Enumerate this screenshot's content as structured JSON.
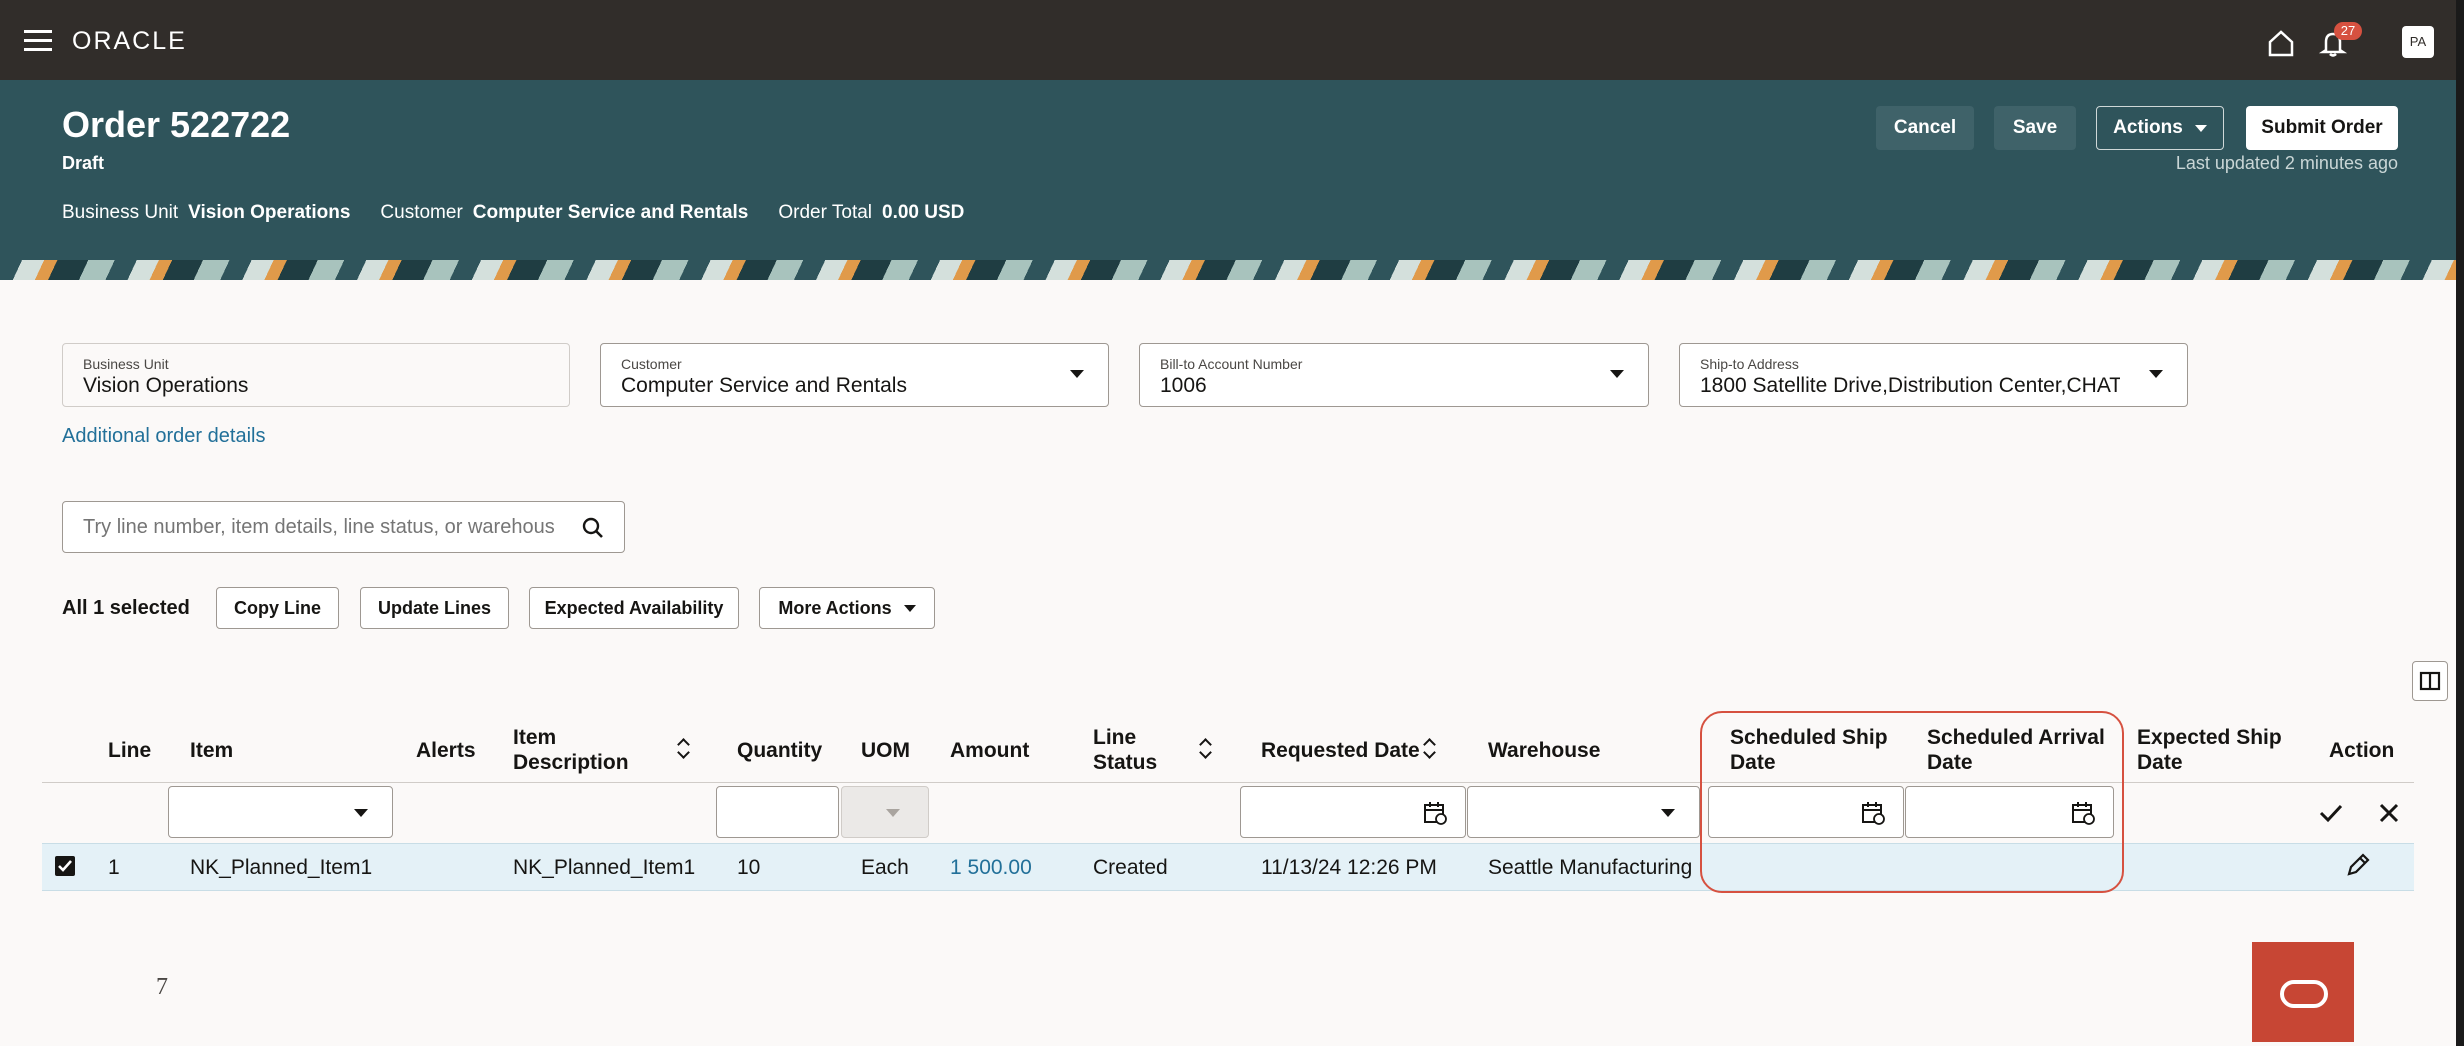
{
  "app": {
    "brand": "ORACLE",
    "notification_count": "27",
    "user_initials": "PA"
  },
  "header": {
    "title": "Order 522722",
    "status": "Draft",
    "meta": [
      {
        "label": "Business Unit",
        "value": "Vision Operations"
      },
      {
        "label": "Customer",
        "value": "Computer Service and Rentals"
      },
      {
        "label": "Order Total",
        "value": "0.00 USD"
      }
    ],
    "buttons": {
      "cancel": "Cancel",
      "save": "Save",
      "actions": "Actions",
      "submit": "Submit Order"
    },
    "last_updated": "Last updated 2 minutes ago"
  },
  "form": {
    "business_unit": {
      "label": "Business Unit",
      "value": "Vision Operations"
    },
    "customer": {
      "label": "Customer",
      "value": "Computer Service and Rentals"
    },
    "bill_to": {
      "label": "Bill-to Account Number",
      "value": "1006"
    },
    "ship_to": {
      "label": "Ship-to Address",
      "value": "1800 Satellite Drive,Distribution Center,CHATT"
    },
    "additional_link": "Additional order details"
  },
  "search": {
    "placeholder": "Try line number, item details, line status, or warehous"
  },
  "toolbar": {
    "selected": "All 1 selected",
    "copy_line": "Copy Line",
    "update_lines": "Update Lines",
    "expected_availability": "Expected Availability",
    "more_actions": "More Actions"
  },
  "table": {
    "columns": {
      "line": "Line",
      "item": "Item",
      "alerts": "Alerts",
      "item_desc_1": "Item",
      "item_desc_2": "Description",
      "quantity": "Quantity",
      "uom": "UOM",
      "amount": "Amount",
      "line_status_1": "Line",
      "line_status_2": "Status",
      "requested_date": "Requested Date",
      "warehouse": "Warehouse",
      "sched_ship_1": "Scheduled Ship",
      "sched_ship_2": "Date",
      "sched_arr_1": "Scheduled Arrival",
      "sched_arr_2": "Date",
      "exp_ship_1": "Expected Ship",
      "exp_ship_2": "Date",
      "action": "Action"
    },
    "rows": [
      {
        "line": "1",
        "item": "NK_Planned_Item1",
        "description": "NK_Planned_Item1",
        "quantity": "10",
        "uom": "Each",
        "amount": "1 500.00",
        "status": "Created",
        "requested_date": "11/13/24 12:26 PM",
        "warehouse": "Seattle Manufacturing",
        "selected": true
      }
    ]
  },
  "footer": {
    "page_number": "7"
  },
  "colors": {
    "topbar": "#312d2a",
    "hero": "#2f545b",
    "link": "#227099",
    "highlight": "#d65140",
    "row_selected": "#e4f1f7",
    "oracle_red": "#c74634"
  }
}
